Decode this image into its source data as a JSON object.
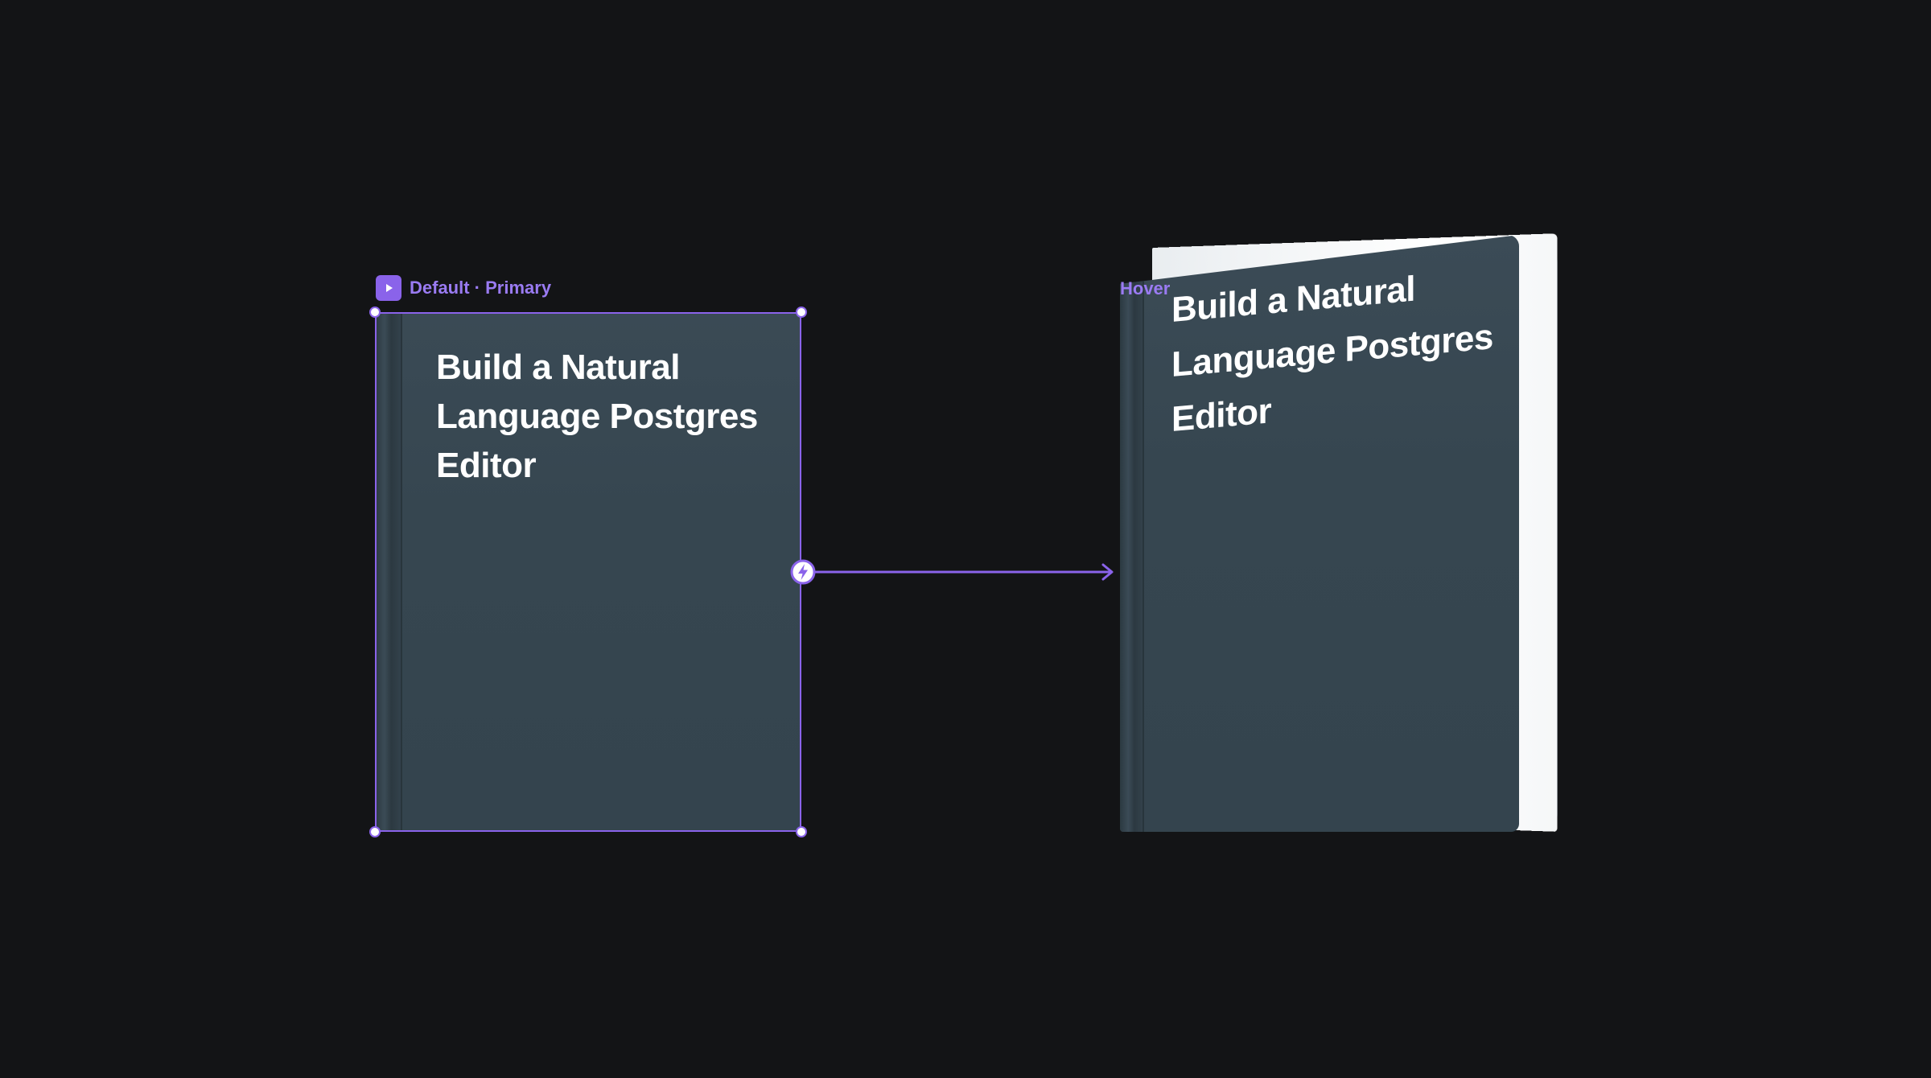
{
  "variants": {
    "default": {
      "label": "Default · Primary",
      "book_title": "Build a Natural Language Postgres Editor"
    },
    "hover": {
      "label": "Hover",
      "book_title": "Build a Natural Language Postgres Editor"
    }
  },
  "icons": {
    "component_badge": "play-component-icon",
    "interaction_trigger": "lightning-bolt-icon",
    "connector_arrow": "arrow-right-icon"
  },
  "colors": {
    "canvas_background": "#131416",
    "accent": "#8a63ea",
    "label_text": "#9a7bf2",
    "book_cover": "#364650",
    "book_spine": "#2c3941",
    "book_pages": "#ffffff",
    "book_title": "#ffffff"
  }
}
